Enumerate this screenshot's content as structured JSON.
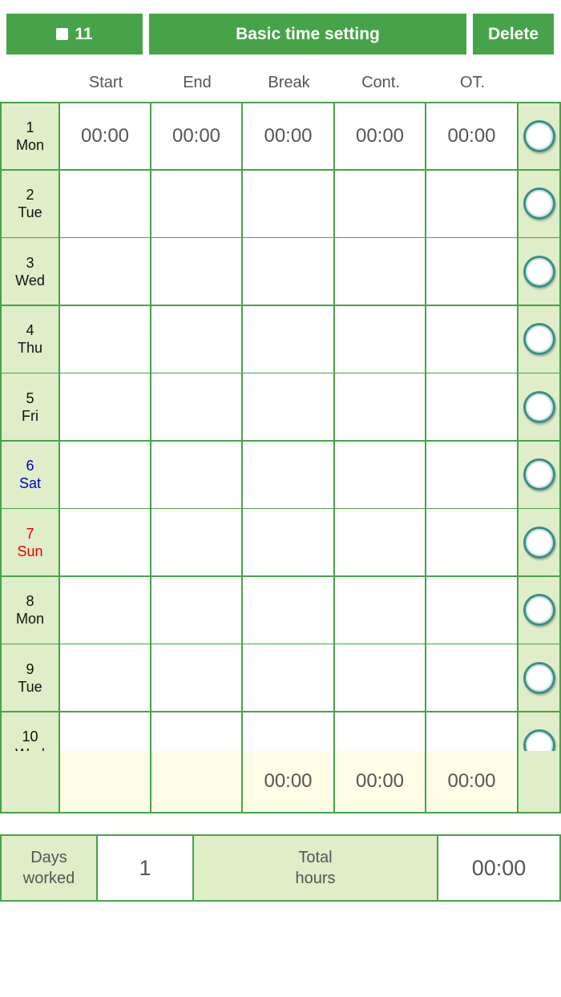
{
  "toolbar": {
    "month_label": "11",
    "basic_label": "Basic time setting",
    "delete_label": "Delete"
  },
  "columns": [
    "Start",
    "End",
    "Break",
    "Cont.",
    "OT."
  ],
  "rows": [
    {
      "day": "1",
      "weekday": "Mon",
      "type": "weekday",
      "times": [
        "00:00",
        "00:00",
        "00:00",
        "00:00",
        "00:00"
      ]
    },
    {
      "day": "2",
      "weekday": "Tue",
      "type": "weekday",
      "times": [
        "",
        "",
        "",
        "",
        ""
      ]
    },
    {
      "day": "3",
      "weekday": "Wed",
      "type": "weekday",
      "times": [
        "",
        "",
        "",
        "",
        ""
      ]
    },
    {
      "day": "4",
      "weekday": "Thu",
      "type": "weekday",
      "times": [
        "",
        "",
        "",
        "",
        ""
      ]
    },
    {
      "day": "5",
      "weekday": "Fri",
      "type": "weekday",
      "times": [
        "",
        "",
        "",
        "",
        ""
      ]
    },
    {
      "day": "6",
      "weekday": "Sat",
      "type": "sat",
      "times": [
        "",
        "",
        "",
        "",
        ""
      ]
    },
    {
      "day": "7",
      "weekday": "Sun",
      "type": "sun",
      "times": [
        "",
        "",
        "",
        "",
        ""
      ]
    },
    {
      "day": "8",
      "weekday": "Mon",
      "type": "weekday",
      "times": [
        "",
        "",
        "",
        "",
        ""
      ]
    },
    {
      "day": "9",
      "weekday": "Tue",
      "type": "weekday",
      "times": [
        "",
        "",
        "",
        "",
        ""
      ]
    },
    {
      "day": "10",
      "weekday": "Wed",
      "type": "weekday",
      "times": [
        "",
        "",
        "",
        "",
        ""
      ]
    }
  ],
  "totals": [
    "",
    "",
    "00:00",
    "00:00",
    "00:00"
  ],
  "summary": {
    "days_label": "Days\nworked",
    "days_value": "1",
    "total_label": "Total\nhours",
    "total_value": "00:00"
  },
  "colors": {
    "accent": "#46a348",
    "label_bg": "#dfedc8",
    "totals_bg": "#fffde6",
    "saturday": "#0000d6",
    "sunday": "#e00000"
  },
  "icons": {
    "month_icon": "stop-square-icon",
    "row_select": "radio-circle-icon"
  }
}
